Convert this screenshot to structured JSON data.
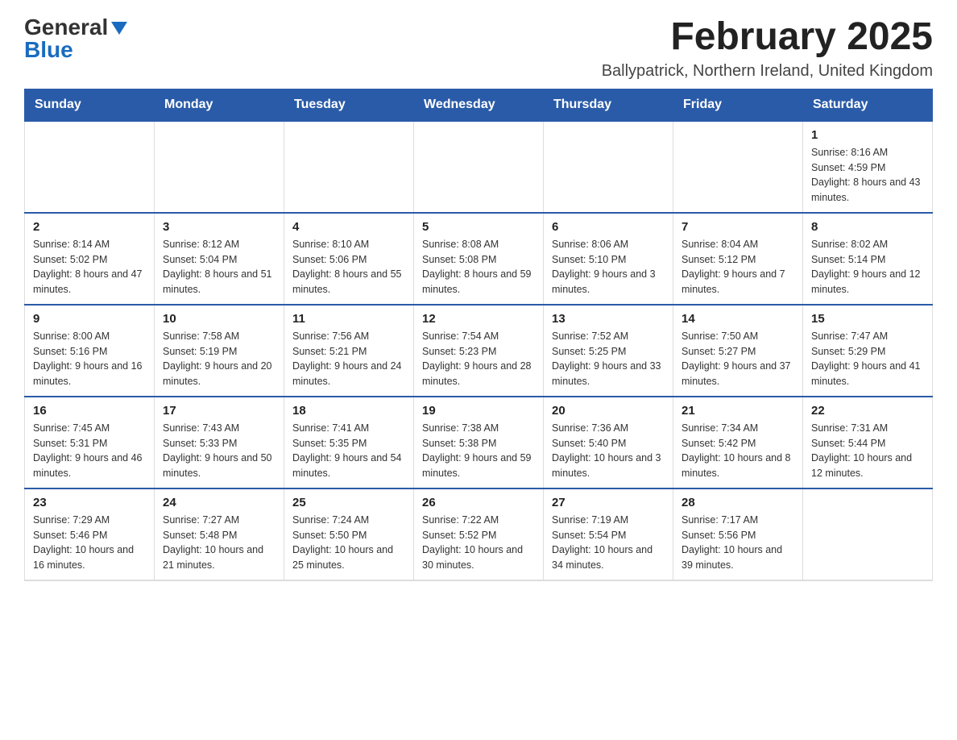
{
  "logo": {
    "general": "General",
    "blue": "Blue"
  },
  "title": "February 2025",
  "subtitle": "Ballypatrick, Northern Ireland, United Kingdom",
  "weekdays": [
    "Sunday",
    "Monday",
    "Tuesday",
    "Wednesday",
    "Thursday",
    "Friday",
    "Saturday"
  ],
  "weeks": [
    [
      {
        "day": "",
        "info": ""
      },
      {
        "day": "",
        "info": ""
      },
      {
        "day": "",
        "info": ""
      },
      {
        "day": "",
        "info": ""
      },
      {
        "day": "",
        "info": ""
      },
      {
        "day": "",
        "info": ""
      },
      {
        "day": "1",
        "info": "Sunrise: 8:16 AM\nSunset: 4:59 PM\nDaylight: 8 hours and 43 minutes."
      }
    ],
    [
      {
        "day": "2",
        "info": "Sunrise: 8:14 AM\nSunset: 5:02 PM\nDaylight: 8 hours and 47 minutes."
      },
      {
        "day": "3",
        "info": "Sunrise: 8:12 AM\nSunset: 5:04 PM\nDaylight: 8 hours and 51 minutes."
      },
      {
        "day": "4",
        "info": "Sunrise: 8:10 AM\nSunset: 5:06 PM\nDaylight: 8 hours and 55 minutes."
      },
      {
        "day": "5",
        "info": "Sunrise: 8:08 AM\nSunset: 5:08 PM\nDaylight: 8 hours and 59 minutes."
      },
      {
        "day": "6",
        "info": "Sunrise: 8:06 AM\nSunset: 5:10 PM\nDaylight: 9 hours and 3 minutes."
      },
      {
        "day": "7",
        "info": "Sunrise: 8:04 AM\nSunset: 5:12 PM\nDaylight: 9 hours and 7 minutes."
      },
      {
        "day": "8",
        "info": "Sunrise: 8:02 AM\nSunset: 5:14 PM\nDaylight: 9 hours and 12 minutes."
      }
    ],
    [
      {
        "day": "9",
        "info": "Sunrise: 8:00 AM\nSunset: 5:16 PM\nDaylight: 9 hours and 16 minutes."
      },
      {
        "day": "10",
        "info": "Sunrise: 7:58 AM\nSunset: 5:19 PM\nDaylight: 9 hours and 20 minutes."
      },
      {
        "day": "11",
        "info": "Sunrise: 7:56 AM\nSunset: 5:21 PM\nDaylight: 9 hours and 24 minutes."
      },
      {
        "day": "12",
        "info": "Sunrise: 7:54 AM\nSunset: 5:23 PM\nDaylight: 9 hours and 28 minutes."
      },
      {
        "day": "13",
        "info": "Sunrise: 7:52 AM\nSunset: 5:25 PM\nDaylight: 9 hours and 33 minutes."
      },
      {
        "day": "14",
        "info": "Sunrise: 7:50 AM\nSunset: 5:27 PM\nDaylight: 9 hours and 37 minutes."
      },
      {
        "day": "15",
        "info": "Sunrise: 7:47 AM\nSunset: 5:29 PM\nDaylight: 9 hours and 41 minutes."
      }
    ],
    [
      {
        "day": "16",
        "info": "Sunrise: 7:45 AM\nSunset: 5:31 PM\nDaylight: 9 hours and 46 minutes."
      },
      {
        "day": "17",
        "info": "Sunrise: 7:43 AM\nSunset: 5:33 PM\nDaylight: 9 hours and 50 minutes."
      },
      {
        "day": "18",
        "info": "Sunrise: 7:41 AM\nSunset: 5:35 PM\nDaylight: 9 hours and 54 minutes."
      },
      {
        "day": "19",
        "info": "Sunrise: 7:38 AM\nSunset: 5:38 PM\nDaylight: 9 hours and 59 minutes."
      },
      {
        "day": "20",
        "info": "Sunrise: 7:36 AM\nSunset: 5:40 PM\nDaylight: 10 hours and 3 minutes."
      },
      {
        "day": "21",
        "info": "Sunrise: 7:34 AM\nSunset: 5:42 PM\nDaylight: 10 hours and 8 minutes."
      },
      {
        "day": "22",
        "info": "Sunrise: 7:31 AM\nSunset: 5:44 PM\nDaylight: 10 hours and 12 minutes."
      }
    ],
    [
      {
        "day": "23",
        "info": "Sunrise: 7:29 AM\nSunset: 5:46 PM\nDaylight: 10 hours and 16 minutes."
      },
      {
        "day": "24",
        "info": "Sunrise: 7:27 AM\nSunset: 5:48 PM\nDaylight: 10 hours and 21 minutes."
      },
      {
        "day": "25",
        "info": "Sunrise: 7:24 AM\nSunset: 5:50 PM\nDaylight: 10 hours and 25 minutes."
      },
      {
        "day": "26",
        "info": "Sunrise: 7:22 AM\nSunset: 5:52 PM\nDaylight: 10 hours and 30 minutes."
      },
      {
        "day": "27",
        "info": "Sunrise: 7:19 AM\nSunset: 5:54 PM\nDaylight: 10 hours and 34 minutes."
      },
      {
        "day": "28",
        "info": "Sunrise: 7:17 AM\nSunset: 5:56 PM\nDaylight: 10 hours and 39 minutes."
      },
      {
        "day": "",
        "info": ""
      }
    ]
  ]
}
